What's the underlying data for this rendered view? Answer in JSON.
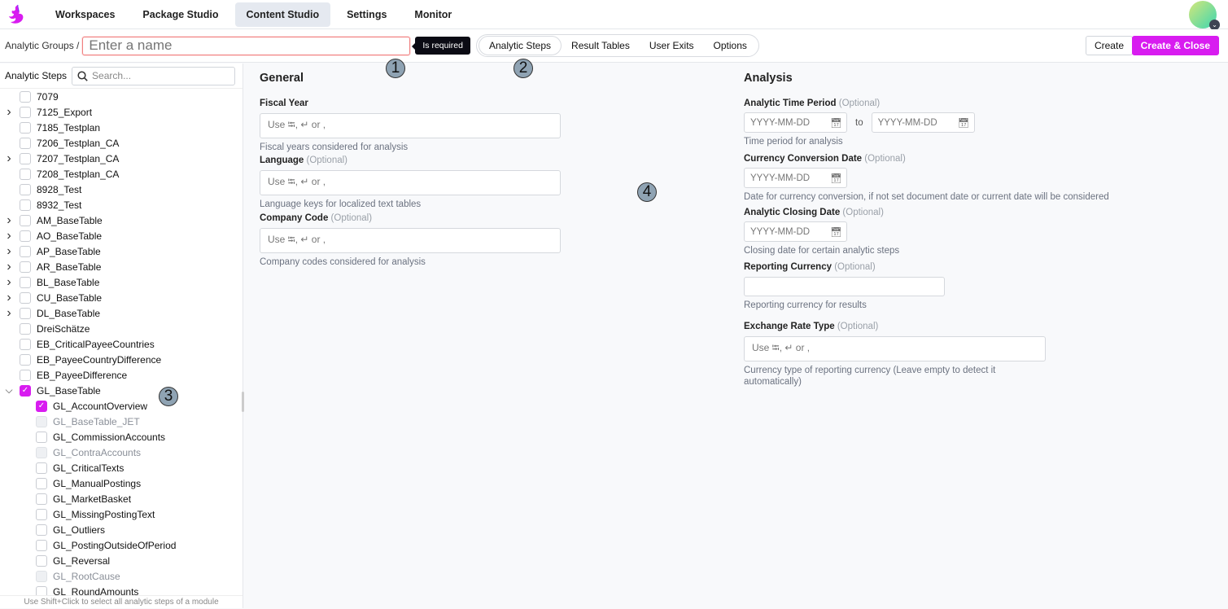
{
  "nav": {
    "items": [
      "Workspaces",
      "Package Studio",
      "Content Studio",
      "Settings",
      "Monitor"
    ],
    "active": "Content Studio"
  },
  "header": {
    "breadcrumb": "Analytic Groups /",
    "name_placeholder": "Enter a name",
    "required_tooltip": "Is required",
    "tabs": [
      "Analytic Steps",
      "Result Tables",
      "User Exits",
      "Options"
    ],
    "create": "Create",
    "create_close": "Create & Close"
  },
  "sidebar": {
    "title": "Analytic Steps",
    "search_placeholder": "Search...",
    "hint": "Use Shift+Click to select all analytic steps of a module",
    "items": [
      {
        "label": "7079",
        "chev": "",
        "state": "off"
      },
      {
        "label": "7125_Export",
        "chev": "right",
        "state": "off"
      },
      {
        "label": "7185_Testplan",
        "chev": "",
        "state": "off"
      },
      {
        "label": "7206_Testplan_CA",
        "chev": "",
        "state": "off"
      },
      {
        "label": "7207_Testplan_CA",
        "chev": "right",
        "state": "off"
      },
      {
        "label": "7208_Testplan_CA",
        "chev": "",
        "state": "off"
      },
      {
        "label": "8928_Test",
        "chev": "",
        "state": "off"
      },
      {
        "label": "8932_Test",
        "chev": "",
        "state": "off"
      },
      {
        "label": "AM_BaseTable",
        "chev": "right",
        "state": "off"
      },
      {
        "label": "AO_BaseTable",
        "chev": "right",
        "state": "off"
      },
      {
        "label": "AP_BaseTable",
        "chev": "right",
        "state": "off"
      },
      {
        "label": "AR_BaseTable",
        "chev": "right",
        "state": "off"
      },
      {
        "label": "BL_BaseTable",
        "chev": "right",
        "state": "off"
      },
      {
        "label": "CU_BaseTable",
        "chev": "right",
        "state": "off"
      },
      {
        "label": "DL_BaseTable",
        "chev": "right",
        "state": "off"
      },
      {
        "label": "DreiSchätze",
        "chev": "",
        "state": "off"
      },
      {
        "label": "EB_CriticalPayeeCountries",
        "chev": "",
        "state": "off"
      },
      {
        "label": "EB_PayeeCountryDifference",
        "chev": "",
        "state": "off"
      },
      {
        "label": "EB_PayeeDifference",
        "chev": "",
        "state": "off"
      },
      {
        "label": "GL_BaseTable",
        "chev": "down",
        "state": "on"
      },
      {
        "label": "GL_AccountOverview",
        "child": true,
        "state": "on"
      },
      {
        "label": "GL_BaseTable_JET",
        "child": true,
        "state": "dis"
      },
      {
        "label": "GL_CommissionAccounts",
        "child": true,
        "state": "off"
      },
      {
        "label": "GL_ContraAccounts",
        "child": true,
        "state": "dis"
      },
      {
        "label": "GL_CriticalTexts",
        "child": true,
        "state": "off"
      },
      {
        "label": "GL_ManualPostings",
        "child": true,
        "state": "off"
      },
      {
        "label": "GL_MarketBasket",
        "child": true,
        "state": "off"
      },
      {
        "label": "GL_MissingPostingText",
        "child": true,
        "state": "off"
      },
      {
        "label": "GL_Outliers",
        "child": true,
        "state": "off"
      },
      {
        "label": "GL_PostingOutsideOfPeriod",
        "child": true,
        "state": "off"
      },
      {
        "label": "GL_Reversal",
        "child": true,
        "state": "off"
      },
      {
        "label": "GL_RootCause",
        "child": true,
        "state": "dis"
      },
      {
        "label": "GL_RoundAmounts",
        "child": true,
        "state": "off"
      }
    ]
  },
  "general": {
    "title": "General",
    "optional": "(Optional)",
    "placeholder": "Use ⭾, ↵ or ,",
    "fiscal_year": {
      "label": "Fiscal Year",
      "help": "Fiscal years considered for analysis"
    },
    "language": {
      "label": "Language",
      "help": "Language keys for localized text tables"
    },
    "company_code": {
      "label": "Company Code",
      "help": "Company codes considered for analysis"
    }
  },
  "analysis": {
    "title": "Analysis",
    "optional": "(Optional)",
    "date_placeholder": "YYYY-MM-DD",
    "to": "to",
    "placeholder": "Use ⭾, ↵ or ,",
    "time_period": {
      "label": "Analytic Time Period",
      "help": "Time period for analysis"
    },
    "conversion_date": {
      "label": "Currency Conversion Date",
      "help": "Date for currency conversion, if not set document date or current date will be considered"
    },
    "closing_date": {
      "label": "Analytic Closing Date",
      "help": "Closing date for certain analytic steps"
    },
    "reporting_currency": {
      "label": "Reporting Currency",
      "help": "Reporting currency for results"
    },
    "exchange_rate": {
      "label": "Exchange Rate Type",
      "help": "Currency type of reporting currency (Leave empty to detect it automatically)"
    }
  },
  "markers": [
    "1",
    "2",
    "3",
    "4"
  ],
  "colors": {
    "accent": "#d81cf0",
    "error": "#f08080"
  }
}
